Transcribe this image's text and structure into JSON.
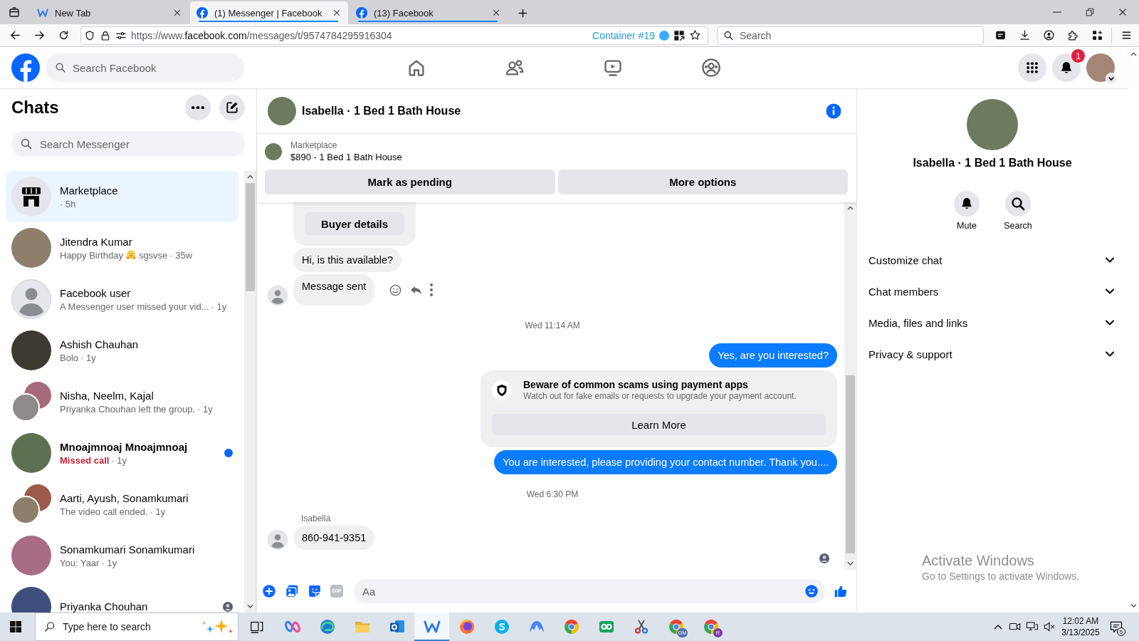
{
  "browser": {
    "tabs": [
      {
        "kind": "w",
        "title": "New Tab",
        "selected": false,
        "container": false
      },
      {
        "kind": "facebook",
        "title": "(1) Messenger | Facebook",
        "selected": true,
        "container": true
      },
      {
        "kind": "facebook",
        "title": "(13) Facebook",
        "selected": false,
        "container": true
      }
    ],
    "url": {
      "prefix": "https://www.",
      "domain": "facebook.com",
      "path": "/messages/t/9574784295916304"
    },
    "container": "Container #19",
    "search_placeholder": "Search"
  },
  "header": {
    "search_placeholder": "Search Facebook",
    "notification_count": "1"
  },
  "chats": {
    "title": "Chats",
    "search_placeholder": "Search Messenger",
    "items": [
      {
        "name": "Marketplace",
        "kind": "store",
        "time": "· 5h",
        "selected": true,
        "unread": false,
        "seen": false
      },
      {
        "name": "Jitendra Kumar",
        "kind": "photo",
        "preview": [
          {
            "kind": "text",
            "text": "Happy Birthday"
          },
          {
            "kind": "emoji"
          },
          {
            "kind": "text",
            "text": "sgsvse"
          }
        ],
        "time": "· 35w",
        "selected": false,
        "unread": false,
        "seen": false
      },
      {
        "name": "Facebook user",
        "kind": "silhouette",
        "preview": [
          {
            "kind": "text",
            "text": "A Messenger user missed your vid..."
          }
        ],
        "time": "· 1y",
        "selected": false,
        "unread": false,
        "seen": false
      },
      {
        "name": "Ashish Chauhan",
        "kind": "photo",
        "preview": [
          {
            "kind": "text",
            "text": "Bolo"
          }
        ],
        "time": "· 1y",
        "selected": false,
        "unread": false,
        "seen": false
      },
      {
        "name": "Nisha, Neelm, Kajal",
        "kind": "group",
        "preview": [
          {
            "kind": "text",
            "text": "Priyanka Chouhan left the group."
          }
        ],
        "time": "· 1y",
        "selected": false,
        "unread": false,
        "seen": false
      },
      {
        "name": "Mnoajmnoaj Mnoajmnoaj",
        "kind": "photo",
        "preview": [
          {
            "kind": "alert",
            "text": "Missed call"
          }
        ],
        "time": "· 1y",
        "selected": false,
        "unread": true,
        "seen": false
      },
      {
        "name": "Aarti, Ayush, Sonamkumari",
        "kind": "group",
        "preview": [
          {
            "kind": "text",
            "text": "The video call ended."
          }
        ],
        "time": "· 1y",
        "selected": false,
        "unread": false,
        "seen": false
      },
      {
        "name": "Sonamkumari Sonamkumari",
        "kind": "photo",
        "preview": [
          {
            "kind": "text",
            "text": "You: Yaar"
          }
        ],
        "time": "· 1y",
        "selected": false,
        "unread": false,
        "seen": false
      },
      {
        "name": "Priyanka Chouhan",
        "kind": "photo",
        "selected": false,
        "unread": false,
        "seen": true
      }
    ]
  },
  "conversation": {
    "title": "Isabella · 1 Bed 1 Bath House",
    "listing": {
      "source": "Marketplace",
      "title": "$890 - 1 Bed 1 Bath House",
      "actions": [
        "Mark as pending",
        "More options"
      ]
    },
    "messages": [
      {
        "kind": "card",
        "button": "Buyer details"
      },
      {
        "kind": "incoming",
        "text": "Hi, is this available?",
        "avatar": false,
        "actions": false
      },
      {
        "kind": "incoming",
        "text": "Message sent",
        "avatar": true,
        "actions": true
      },
      {
        "kind": "time",
        "text": "Wed 11:14 AM"
      },
      {
        "kind": "outgoing",
        "text": "Yes, are you interested?"
      },
      {
        "kind": "notice",
        "title": "Beware of common scams using payment apps",
        "text": "Watch out for fake emails or requests to upgrade your payment account.",
        "button": "Learn More"
      },
      {
        "kind": "outgoing",
        "text": "You are interested, please providing your contact number. Thank you...."
      },
      {
        "kind": "time",
        "text": "Wed 6:30 PM"
      },
      {
        "kind": "sender",
        "text": "Isabella"
      },
      {
        "kind": "incoming",
        "text": "860-941-9351",
        "avatar": true,
        "actions": false
      }
    ],
    "read_receipt": true,
    "composer": {
      "gif": "GIF",
      "placeholder": "Aa"
    }
  },
  "details": {
    "title": "Isabella · 1 Bed 1 Bath House",
    "actions": [
      {
        "kind": "mute",
        "label": "Mute"
      },
      {
        "kind": "search",
        "label": "Search"
      }
    ],
    "sections": [
      {
        "label": "Customize chat",
        "expanded": false
      },
      {
        "label": "Chat members",
        "expanded": false
      },
      {
        "label": "Media, files and links",
        "expanded": false
      },
      {
        "label": "Privacy & support",
        "expanded": false
      }
    ]
  },
  "activation_notice": {
    "title": "Activate Windows",
    "text": "Go to Settings to activate Windows."
  },
  "taskbar": {
    "search_placeholder": "Type here to search",
    "apps": [
      {
        "kind": "copilot",
        "active": false
      },
      {
        "kind": "edge",
        "active": false
      },
      {
        "kind": "explorer",
        "active": false
      },
      {
        "kind": "outlook",
        "active": false
      },
      {
        "kind": "w",
        "active": true
      },
      {
        "kind": "firefox",
        "active": false
      },
      {
        "kind": "skype",
        "active": false
      },
      {
        "kind": "mountain",
        "active": false
      },
      {
        "kind": "chrome",
        "active": false
      },
      {
        "kind": "rings",
        "active": false
      },
      {
        "kind": "scissors",
        "active": false
      },
      {
        "kind": "chrome",
        "active": false,
        "badge": "GM",
        "color": "#4f6fb0"
      },
      {
        "kind": "chrome",
        "active": false,
        "badge": "R",
        "color": "#7c3aad"
      }
    ],
    "clock": {
      "time": "12:02 AM",
      "date": "3/13/2025"
    },
    "notification_count": "5"
  }
}
